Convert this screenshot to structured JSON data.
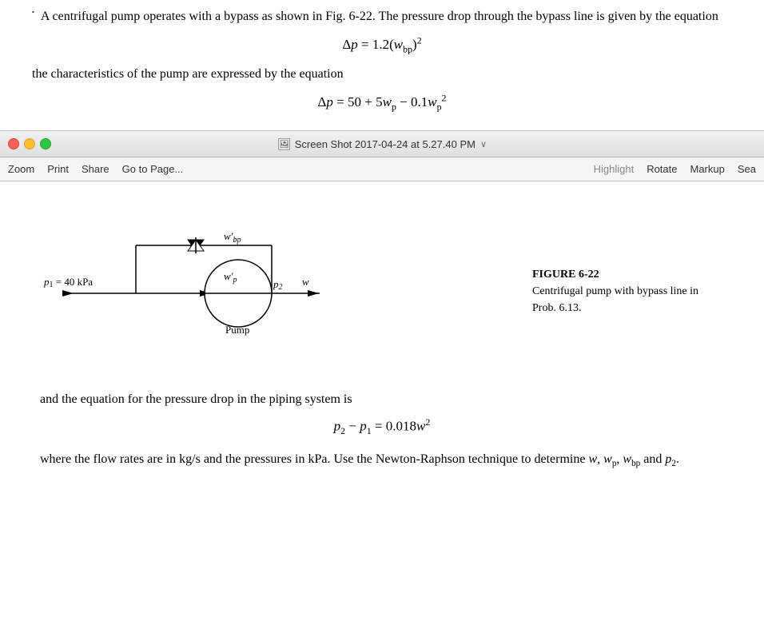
{
  "titleBar": {
    "title": "Screen Shot 2017-04-24 at 5.27.40 PM",
    "chevron": "∨"
  },
  "toolbar": {
    "items": [
      "Zoom",
      "Print",
      "Share",
      "Go to Page..."
    ],
    "rightItems": [
      "Highlight",
      "Rotate",
      "Markup",
      "Sea"
    ]
  },
  "document": {
    "intro_text": "A centrifugal pump operates with a bypass as shown in Fig. 6-22. The pressure drop through the bypass line is given by the equation",
    "eq1": "Δp = 1.2(w",
    "eq1_sub": "bp",
    "eq1_end": ")",
    "eq1_sup": "2",
    "char_text": "the characteristics of the pump are expressed by the equation",
    "eq2": "Δp = 50 + 5w",
    "eq2_sub": "p",
    "eq2_mid": " − 0.1w",
    "eq2_sub2": "p",
    "eq2_sup": "2",
    "figure_caption_title": "FIGURE 6-22",
    "figure_caption_text": "Centrifugal pump with bypass line in Prob. 6.13.",
    "eq3_text": "and the equation for the pressure drop in the piping system is",
    "eq3": "p2 − p1 = 0.018w",
    "eq3_sup": "2",
    "final_text": "where the flow rates are in kg/s and the pressures in kPa. Use the Newton-Raphson technique to determine w, w",
    "final_subs": [
      "p",
      "bp"
    ],
    "final_end": " and p",
    "final_sub_end": "2",
    "labels": {
      "p1": "p₁ = 40 kPa",
      "pump": "Pump",
      "wbp": "w'bp",
      "wp": "w'p",
      "w": "w",
      "p2": "p₂"
    }
  }
}
